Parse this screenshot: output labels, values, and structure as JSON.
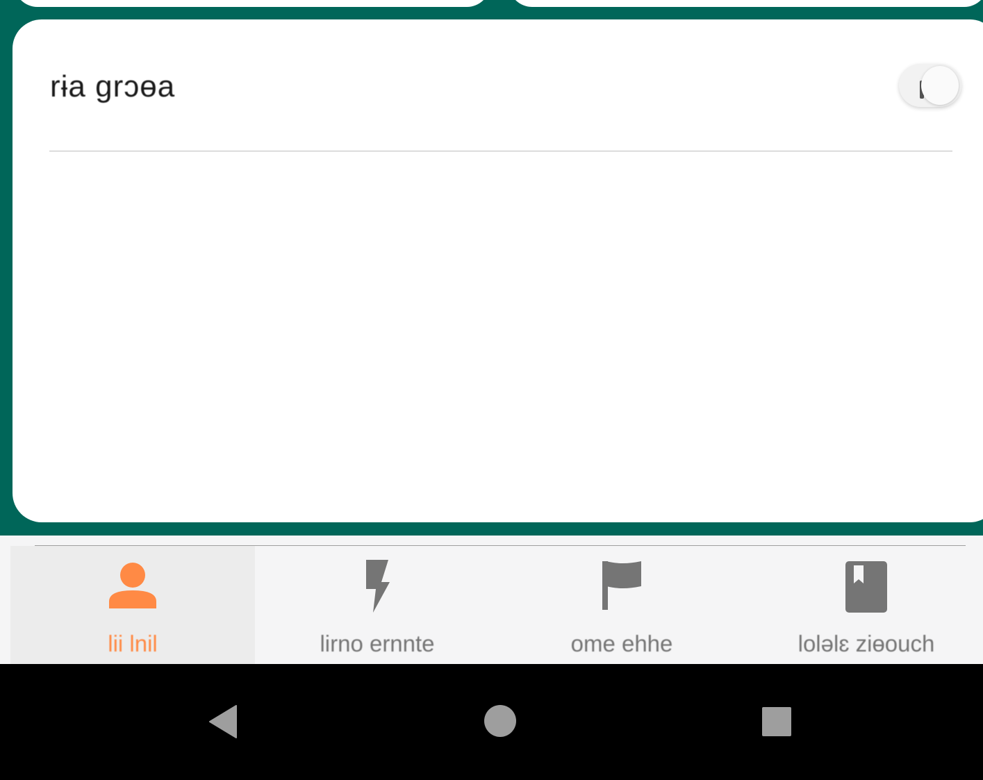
{
  "card": {
    "title": "rɨa ɡrɔɵa"
  },
  "nav": {
    "items": [
      {
        "label": "lii lnil",
        "icon": "person-icon",
        "active": true
      },
      {
        "label": "lirno ernnte",
        "icon": "lightning-icon",
        "active": false
      },
      {
        "label": "ome ehhe",
        "icon": "flag-icon",
        "active": false
      },
      {
        "label": "loləlɛ ziɵouch",
        "icon": "book-icon",
        "active": false
      }
    ]
  },
  "colors": {
    "header_bg": "#006659",
    "accent": "#ff8a45",
    "inactive": "#757575",
    "nav_bg": "#f5f5f6"
  },
  "system": {
    "buttons": [
      "back-icon",
      "home-icon",
      "recents-icon"
    ]
  }
}
